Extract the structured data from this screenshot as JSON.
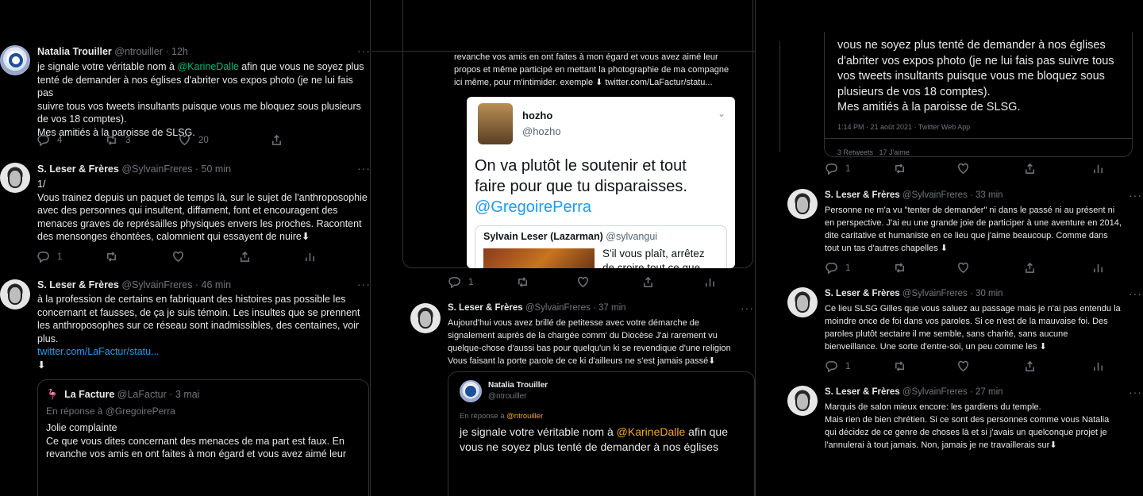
{
  "p1": {
    "t1": {
      "name": "Natalia Trouiller",
      "handle": "@ntrouiller · 12h",
      "more": "···",
      "line1a": "je signale votre véritable nom à ",
      "mention": "@KarineDalle",
      "line1b": " afin que vous ne soyez plus",
      "line2": "tenté de demander à nos églises d'abriter vos expos photo (je ne lui fais pas",
      "line3": "suivre tous vos tweets insultants puisque vous me bloquez sous plusieurs",
      "line4": "de vos 18 comptes).",
      "line5": "Mes amitiés à la paroisse de SLSG.",
      "replies": "4",
      "retweets": "3",
      "likes": "20"
    },
    "t2": {
      "name": "S. Leser & Frères",
      "handle": "@SylvainFreres · 50 min",
      "more": "···",
      "lines": [
        "1/",
        "Vous trainez depuis un paquet de temps là, sur le sujet de l'anthroposophie",
        "avec des personnes qui insultent, diffament, font et encouragent des",
        "menaces graves de représailles physiques envers les proches. Racontent",
        "des mensonges éhontées, calomnient qui essayent de nuire⬇"
      ],
      "replies": "1"
    },
    "t3": {
      "name": "S. Leser & Frères",
      "handle": "@SylvainFreres · 46 min",
      "more": "···",
      "lines": [
        "à la profession de certains en fabriquant des histoires pas possible les",
        "concernant et fausses, de ça je suis témoin. Les insultes que se prennent",
        "les anthroposophes sur ce réseau sont inadmissibles, des centaines, voir",
        "plus."
      ],
      "link": "twitter.com/LaFactur/statu...",
      "arrow": "⬇",
      "quote": {
        "name": "La Facture",
        "handle": "@LaFactur · 3 mai",
        "reply_to": "En réponse à @GregoirePerra",
        "lines": [
          "Jolie complainte",
          "Ce que vous dites concernant des menaces de ma part est faux. En",
          "revanche vos amis en ont faites à mon égard et vous avez aimé leur"
        ]
      }
    }
  },
  "p2": {
    "top_lines": [
      "revanche vos amis en ont faites à mon égard et vous avez aimé leur",
      "propos et même participé en mettant la photographie de ma compagne",
      "ici même, pour m'intimider. exemple ⬇ twitter.com/LaFactur/statu..."
    ],
    "embed": {
      "name": "hozho",
      "handle": "@hozho",
      "text1": "On va plutôt le soutenir et tout",
      "text2": "faire pour que tu disparaisses.",
      "mention": "@GregoirePerra",
      "inner_name": "Sylvain Leser (Lazarman)",
      "inner_handle": "@sylvangui",
      "inner_text1": "S'il vous plaît, arrêtez",
      "inner_text2": "de croire tout ce que"
    },
    "t1_replies": "1",
    "t2": {
      "name": "S. Leser & Frères",
      "handle": "@SylvainFreres · 37 min",
      "more": "···",
      "lines": [
        "Aujourd'hui vous avez brillé de petitesse avec votre démarche de",
        "signalement auprès de la chargée comm' du Diocèse J'ai rarement vu",
        "quelque-chose d'aussi bas pour quelqu'un ki se revendique d'une religion",
        "Vous faisant la porte parole de ce ki d'ailleurs ne s'est jamais passé⬇"
      ],
      "quote": {
        "name": "Natalia Trouiller",
        "handle": "@ntrouiller",
        "reply_prefix": "En réponse à ",
        "reply_mention": "@ntrouiller",
        "line1a": "je signale votre véritable nom à ",
        "mention": "@KarineDalle",
        "line1b": " afin que",
        "line2": "vous ne soyez plus tenté de demander à nos églises"
      }
    }
  },
  "p3": {
    "top": {
      "lines": [
        "vous ne soyez plus tenté de demander à nos églises",
        "d'abriter vos expos photo (je ne lui fais pas suivre tous",
        "vos tweets insultants puisque vous me bloquez sous",
        "plusieurs de vos 18 comptes).",
        "Mes amitiés à la paroisse de SLSG."
      ],
      "meta": "1:14 PM · 21 août 2021 · Twitter Web App",
      "stats": "3 Retweets   17 J'aime"
    },
    "top_replies": "1",
    "t1": {
      "name": "S. Leser & Frères",
      "handle": "@SylvainFreres · 33 min",
      "more": "···",
      "lines": [
        "Personne ne m'a vu \"tenter de demander\" ni dans le passé ni au présent ni",
        "en perspective. J'ai eu une grande joie de participer à une aventure en 2014,",
        "dite caritative et humaniste en ce lieu que j'aime beaucoup. Comme dans",
        "tout un tas d'autres chapelles ⬇"
      ],
      "replies": "1"
    },
    "t2": {
      "name": "S. Leser & Frères",
      "handle": "@SylvainFreres · 30 min",
      "more": "···",
      "lines": [
        "Ce lieu SLSG Gilles que vous saluez au passage mais je n'ai pas entendu la",
        "moindre once de foi dans vos paroles. Si ce n'est de la mauvaise foi. Des",
        "paroles plutôt sectaire il me semble, sans charité, sans aucune",
        "bienveillance. Une sorte d'entre-soi, un peu comme les ⬇"
      ],
      "replies": "1"
    },
    "t3": {
      "name": "S. Leser & Frères",
      "handle": "@SylvainFreres · 27 min",
      "more": "···",
      "lines": [
        "Marquis de salon mieux encore: les gardiens du temple.",
        "Mais rien de bien chrétien. Si ce sont des personnes comme vous Natalia",
        "qui décidez de ce genre de choses là et si j'avais un quelconque projet je",
        "l'annulerai à tout jamais. Non, jamais je ne travaillerais sur⬇"
      ]
    }
  }
}
